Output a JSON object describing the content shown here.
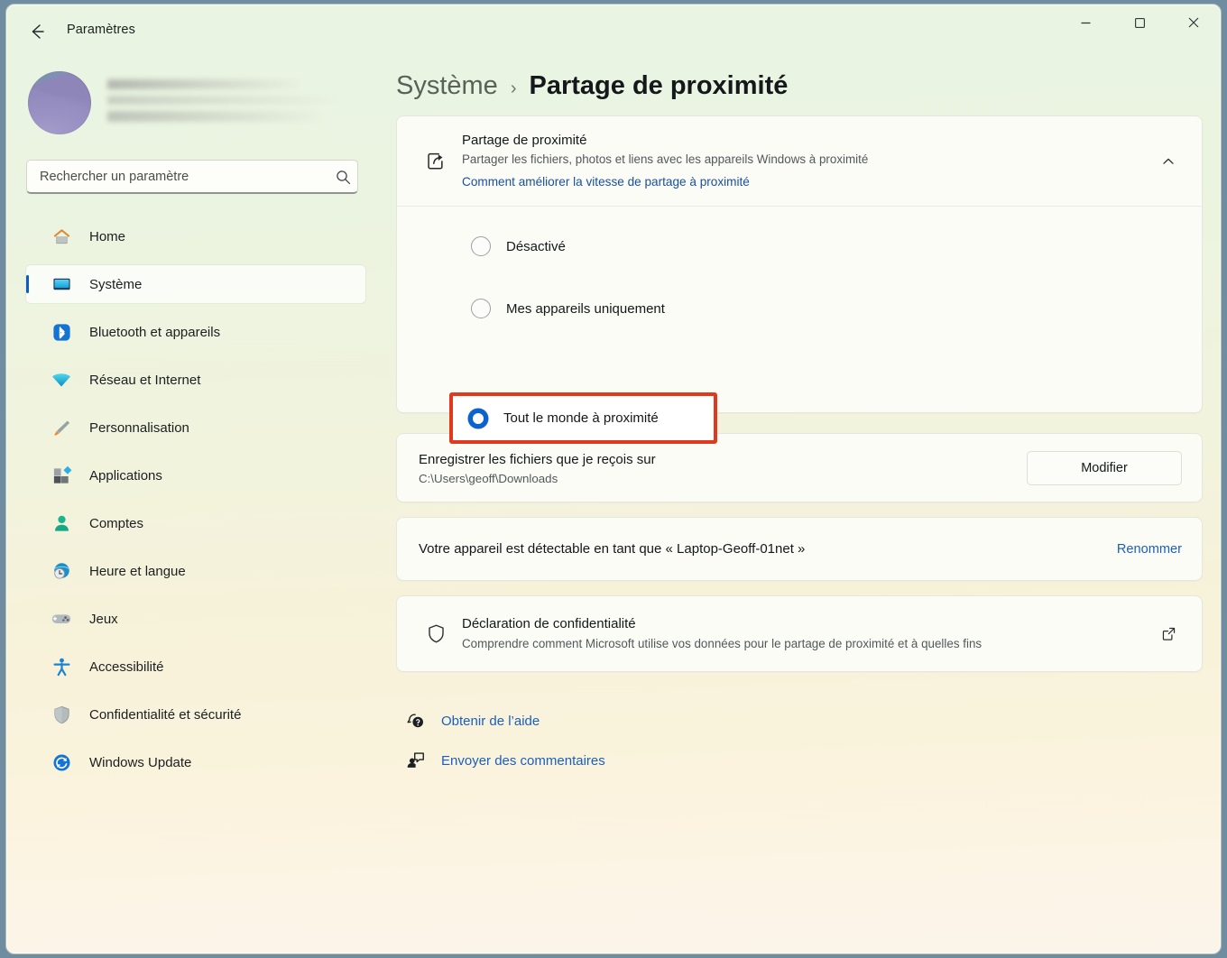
{
  "window": {
    "app_title": "Paramètres",
    "back_icon": "back-arrow-icon",
    "minimize_label": "—",
    "maximize_label": "□",
    "close_label": "✕"
  },
  "sidebar": {
    "account": {
      "name_redacted": "",
      "avatar_alt": "user-avatar"
    },
    "search": {
      "placeholder": "Rechercher un paramètre",
      "value": "",
      "icon": "search-icon"
    },
    "items": [
      {
        "label": "Home",
        "icon": "home-icon",
        "active": false
      },
      {
        "label": "Système",
        "icon": "display-icon",
        "active": true
      },
      {
        "label": "Bluetooth et appareils",
        "icon": "bluetooth-icon",
        "active": false
      },
      {
        "label": "Réseau et Internet",
        "icon": "wifi-icon",
        "active": false
      },
      {
        "label": "Personnalisation",
        "icon": "paintbrush-icon",
        "active": false
      },
      {
        "label": "Applications",
        "icon": "apps-icon",
        "active": false
      },
      {
        "label": "Comptes",
        "icon": "person-icon",
        "active": false
      },
      {
        "label": "Heure et langue",
        "icon": "clock-globe-icon",
        "active": false
      },
      {
        "label": "Jeux",
        "icon": "gamepad-icon",
        "active": false
      },
      {
        "label": "Accessibilité",
        "icon": "accessibility-icon",
        "active": false
      },
      {
        "label": "Confidentialité et sécurité",
        "icon": "shield-icon",
        "active": false
      },
      {
        "label": "Windows Update",
        "icon": "update-icon",
        "active": false
      }
    ]
  },
  "breadcrumb": {
    "parent": "Système",
    "separator": "›",
    "current": "Partage de proximité"
  },
  "main": {
    "share_card": {
      "icon": "share-icon",
      "title": "Partage de proximité",
      "subtitle": "Partager les fichiers, photos et liens avec les appareils Windows à proximité",
      "link": "Comment améliorer la vitesse de partage à proximité",
      "chevron": "chevron-up-icon",
      "options": [
        {
          "label": "Désactivé",
          "selected": false
        },
        {
          "label": "Mes appareils uniquement",
          "selected": false
        },
        {
          "label": "Tout le monde à proximité",
          "selected": true,
          "highlighted": true
        }
      ]
    },
    "save_location_card": {
      "title": "Enregistrer les fichiers que je reçois sur",
      "path": "C:\\Users\\geoff\\Downloads",
      "button": "Modifier"
    },
    "device_name_card": {
      "text": "Votre appareil est détectable en tant que « Laptop-Geoff-01net »",
      "action": "Renommer"
    },
    "privacy_card": {
      "icon": "shield-outline-icon",
      "title": "Déclaration de confidentialité",
      "subtitle": "Comprendre comment Microsoft utilise vos données pour le partage de proximité et à quelles fins",
      "external_icon": "external-link-icon"
    },
    "footer_links": [
      {
        "label": "Obtenir de l’aide",
        "icon": "help-icon"
      },
      {
        "label": "Envoyer des commentaires",
        "icon": "feedback-icon"
      }
    ]
  },
  "colors": {
    "accent_blue": "#0a63ce",
    "link_blue": "#1a5fbd",
    "highlight_red": "#e03a1e",
    "card_bg": "#fbfcf6"
  }
}
